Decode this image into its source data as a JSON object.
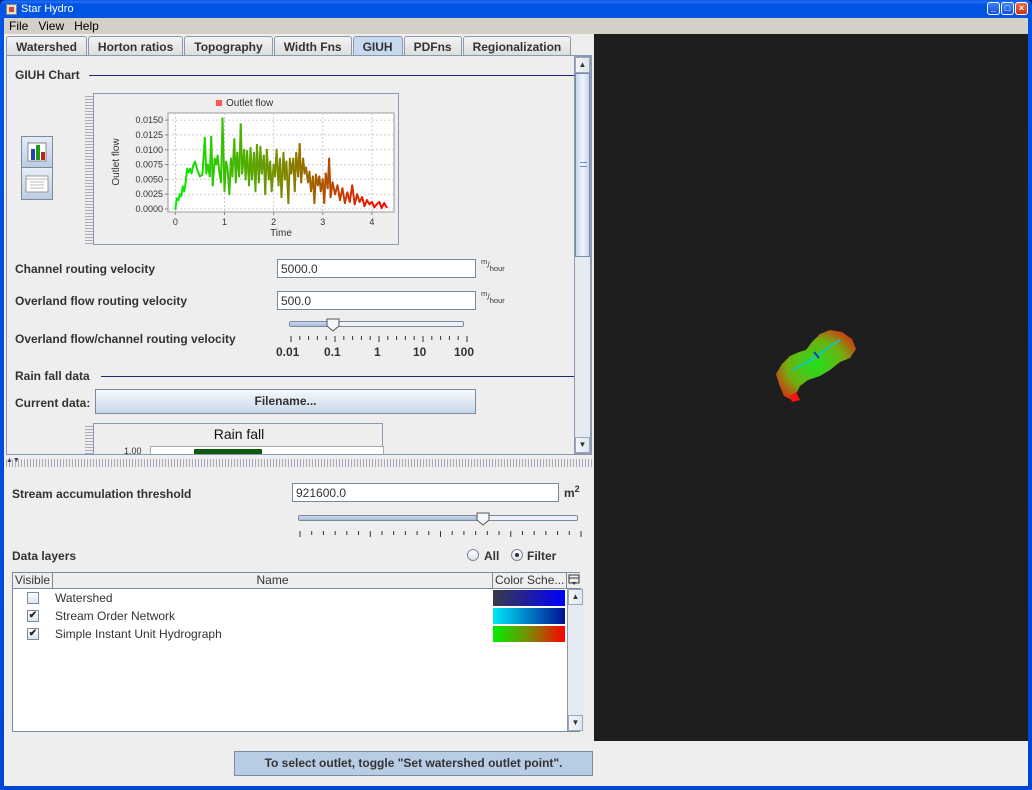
{
  "window": {
    "title": "Star Hydro",
    "buttons": [
      "minimize",
      "maximize",
      "close"
    ]
  },
  "menu": [
    "File",
    "View",
    "Help"
  ],
  "tabs": [
    {
      "label": "Watershed",
      "active": false
    },
    {
      "label": "Horton ratios",
      "active": false
    },
    {
      "label": "Topography",
      "active": false
    },
    {
      "label": "Width Fns",
      "active": false
    },
    {
      "label": "GIUH",
      "active": true
    },
    {
      "label": "PDFns",
      "active": false
    },
    {
      "label": "Regionalization",
      "active": false
    }
  ],
  "giuh": {
    "section_title": "GIUH Chart",
    "chart_tool_icons": [
      "bar-chart-icon",
      "table-view-icon"
    ],
    "channel_velocity": {
      "label": "Channel routing velocity",
      "value": "5000.0",
      "unit_num": "m",
      "unit_den": "hour"
    },
    "overland_velocity": {
      "label": "Overland flow routing velocity",
      "value": "500.0",
      "unit_num": "m",
      "unit_den": "hour"
    },
    "ratio_slider": {
      "label": "Overland flow/channel routing velocity",
      "tick_labels": [
        "0.01",
        "0.1",
        "1",
        "10",
        "100"
      ],
      "value": 0.1
    },
    "rainfall": {
      "section_title": "Rain fall data",
      "current_label": "Current data:",
      "file_button": "Filename...",
      "chart_title": "Rain fall",
      "y_tick_visible": "1.00"
    }
  },
  "chart_data": {
    "type": "line",
    "title": "",
    "legend": [
      "Outlet flow"
    ],
    "legend_position": "top",
    "xlabel": "Time",
    "ylabel": "Outlet flow",
    "xlim": [
      -0.15,
      4.45
    ],
    "ylim": [
      -0.0005,
      0.0162
    ],
    "xticks": [
      "0",
      "1",
      "2",
      "3",
      "4"
    ],
    "yticks": [
      "0.0000",
      "0.0025",
      "0.0050",
      "0.0075",
      "0.0100",
      "0.0125",
      "0.0150"
    ],
    "grid": true,
    "color_gradient": [
      "#00ee00",
      "#7a8c00",
      "#ff0000"
    ],
    "series": [
      {
        "name": "Outlet flow",
        "x": [
          0.0,
          0.03,
          0.06,
          0.09,
          0.12,
          0.15,
          0.18,
          0.21,
          0.24,
          0.27,
          0.3,
          0.33,
          0.36,
          0.4,
          0.45,
          0.5,
          0.55,
          0.6,
          0.63,
          0.66,
          0.7,
          0.73,
          0.76,
          0.8,
          0.83,
          0.86,
          0.9,
          0.93,
          0.96,
          1.0,
          1.03,
          1.06,
          1.1,
          1.13,
          1.16,
          1.2,
          1.23,
          1.26,
          1.3,
          1.33,
          1.36,
          1.4,
          1.43,
          1.46,
          1.5,
          1.53,
          1.56,
          1.6,
          1.63,
          1.66,
          1.7,
          1.73,
          1.76,
          1.8,
          1.83,
          1.86,
          1.9,
          1.93,
          1.96,
          2.0,
          2.03,
          2.06,
          2.1,
          2.13,
          2.16,
          2.2,
          2.23,
          2.26,
          2.3,
          2.33,
          2.36,
          2.4,
          2.43,
          2.46,
          2.5,
          2.53,
          2.56,
          2.6,
          2.63,
          2.66,
          2.7,
          2.73,
          2.76,
          2.8,
          2.83,
          2.86,
          2.9,
          2.93,
          2.96,
          3.0,
          3.03,
          3.06,
          3.1,
          3.13,
          3.16,
          3.2,
          3.25,
          3.3,
          3.35,
          3.4,
          3.45,
          3.5,
          3.55,
          3.6,
          3.65,
          3.7,
          3.75,
          3.8,
          3.85,
          3.9,
          3.95,
          4.0,
          4.05,
          4.1,
          4.15,
          4.2,
          4.25,
          4.3
        ],
        "y": [
          0.0,
          0.0018,
          0.0015,
          0.0025,
          0.0022,
          0.0038,
          0.003,
          0.0045,
          0.0068,
          0.0062,
          0.0068,
          0.006,
          0.0072,
          0.008,
          0.0065,
          0.0055,
          0.0058,
          0.012,
          0.006,
          0.0075,
          0.0055,
          0.0122,
          0.004,
          0.0085,
          0.0075,
          0.009,
          0.006,
          0.0045,
          0.0153,
          0.003,
          0.008,
          0.007,
          0.0025,
          0.0085,
          0.0055,
          0.0118,
          0.0045,
          0.0095,
          0.0055,
          0.0143,
          0.006,
          0.01,
          0.005,
          0.0098,
          0.004,
          0.0103,
          0.005,
          0.0095,
          0.003,
          0.0108,
          0.0045,
          0.0105,
          0.006,
          0.009,
          0.0025,
          0.01,
          0.005,
          0.008,
          0.003,
          0.0075,
          0.0055,
          0.01,
          0.004,
          0.0085,
          0.002,
          0.0095,
          0.005,
          0.008,
          0.001,
          0.0085,
          0.006,
          0.0085,
          0.003,
          0.0095,
          0.0055,
          0.011,
          0.0045,
          0.0085,
          0.006,
          0.007,
          0.0045,
          0.0063,
          0.003,
          0.0055,
          0.001,
          0.0058,
          0.004,
          0.0055,
          0.003,
          0.005,
          0.001,
          0.006,
          0.0035,
          0.0085,
          0.002,
          0.0045,
          0.0025,
          0.004,
          0.0015,
          0.0035,
          0.001,
          0.0028,
          0.0012,
          0.004,
          0.0008,
          0.0025,
          0.0012,
          0.002,
          0.0005,
          0.0015,
          0.0008,
          0.0012,
          0.0003,
          0.0008,
          0.0012,
          0.0002,
          0.001,
          0.0003
        ],
        "note": "values estimated from pixel positions"
      }
    ]
  },
  "stream": {
    "label": "Stream accumulation threshold",
    "value": "921600.0",
    "unit": "m",
    "unit_exp": "2",
    "slider_value_fraction": 0.67
  },
  "layers": {
    "label": "Data layers",
    "radio": [
      {
        "label": "All",
        "selected": false
      },
      {
        "label": "Filter",
        "selected": true
      }
    ],
    "columns": [
      "Visible",
      "Name",
      "Color Sche..."
    ],
    "rows": [
      {
        "visible": false,
        "name": "Watershed",
        "gradient": [
          "#3a3a48",
          "#0000ff"
        ]
      },
      {
        "visible": true,
        "name": "Stream Order Network",
        "gradient": [
          "#00e8f8",
          "#001090"
        ]
      },
      {
        "visible": true,
        "name": "Simple Instant Unit Hydrograph",
        "gradient": [
          "#00ee00",
          "#ff0000"
        ]
      }
    ]
  },
  "status": {
    "message": "To select outlet, toggle \"Set watershed outlet point\"."
  }
}
